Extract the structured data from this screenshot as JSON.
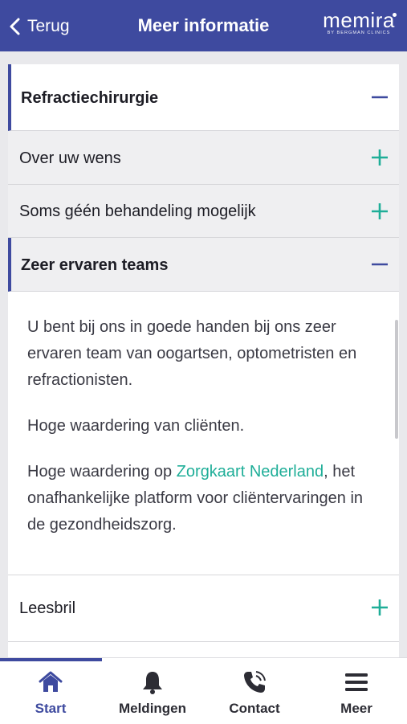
{
  "header": {
    "back_label": "Terug",
    "title": "Meer informatie",
    "logo_word": "memira",
    "logo_subtitle": "BY BERGMAN CLINICS"
  },
  "accordion": [
    {
      "label": "Refractiechirurgie",
      "state": "expanded"
    },
    {
      "label": "Over uw wens",
      "state": "collapsed"
    },
    {
      "label": "Soms géén behandeling mogelijk",
      "state": "collapsed"
    },
    {
      "label": "Zeer ervaren teams",
      "state": "expanded"
    },
    {
      "label": "Leesbril",
      "state": "collapsed"
    }
  ],
  "panel": {
    "paragraph1": "U bent bij ons in goede handen bij ons zeer ervaren team van oogartsen, optometristen en refractionisten.",
    "paragraph2": "Hoge waardering van cliënten.",
    "paragraph3_prefix": "Hoge waardering op ",
    "paragraph3_link": "Zorgkaart Nederland",
    "paragraph3_suffix": ", het onafhankelijke platform voor cliëntervaringen in de gezondheidszorg."
  },
  "bottom_nav": [
    {
      "label": "Start",
      "icon": "home-icon",
      "active": true
    },
    {
      "label": "Meldingen",
      "icon": "bell-icon",
      "active": false
    },
    {
      "label": "Contact",
      "icon": "phone-icon",
      "active": false
    },
    {
      "label": "Meer",
      "icon": "menu-icon",
      "active": false
    }
  ],
  "colors": {
    "brand": "#3e4a9f",
    "accent": "#1fae98",
    "background": "#e9e9ec"
  }
}
